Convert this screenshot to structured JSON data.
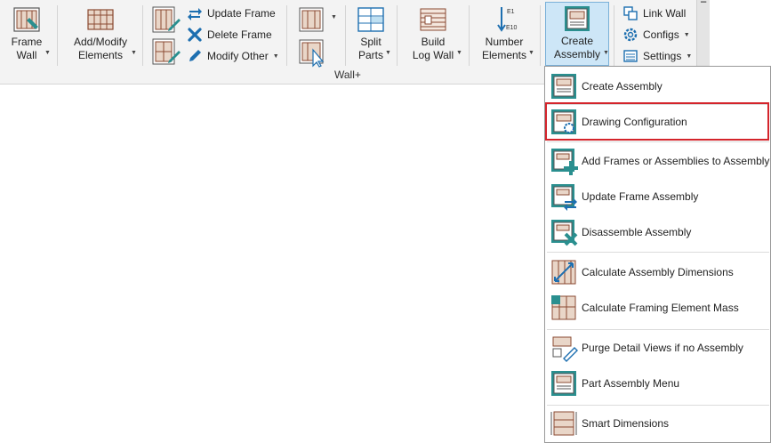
{
  "ribbon": {
    "panel_label": "Wall+",
    "frame_wall": {
      "line1": "Frame",
      "line2": "Wall"
    },
    "add_modify": {
      "line1": "Add/Modify",
      "line2": "Elements"
    },
    "update_frame": "Update Frame",
    "delete_frame": "Delete Frame",
    "modify_other": "Modify Other",
    "split_parts": {
      "line1": "Split",
      "line2": "Parts"
    },
    "build_log_wall": {
      "line1": "Build",
      "line2": "Log Wall"
    },
    "number_elements": {
      "line1": "Number",
      "line2": "Elements",
      "e_top": "E1",
      "e_bottom": "E10"
    },
    "create_assembly": {
      "line1": "Create",
      "line2": "Assembly"
    },
    "link_wall": "Link Wall",
    "configs": "Configs",
    "settings": "Settings"
  },
  "menu": {
    "items": [
      {
        "label": "Create  Assembly",
        "icon": "create-assembly-icon"
      },
      {
        "label": "Drawing Configuration",
        "icon": "drawing-configuration-icon"
      },
      {
        "label": "Add Frames or Assemblies to Assembly",
        "icon": "add-frames-icon"
      },
      {
        "label": "Update Frame Assembly",
        "icon": "update-frame-assembly-icon"
      },
      {
        "label": "Disassemble Assembly",
        "icon": "disassemble-assembly-icon"
      },
      {
        "label": "Calculate Assembly Dimensions",
        "icon": "calculate-dimensions-icon"
      },
      {
        "label": "Calculate Framing Element Mass",
        "icon": "calculate-mass-icon"
      },
      {
        "label": "Purge Detail Views if no Assembly",
        "icon": "purge-detail-views-icon"
      },
      {
        "label": "Part Assembly Menu",
        "icon": "part-assembly-menu-icon"
      },
      {
        "label": "Smart Dimensions",
        "icon": "smart-dimensions-icon"
      }
    ]
  },
  "colors": {
    "accent_teal": "#2a8f8f",
    "frame_brown": "#8a4a32",
    "highlight_red": "#d4242b",
    "active_blue": "#cde6f7"
  }
}
